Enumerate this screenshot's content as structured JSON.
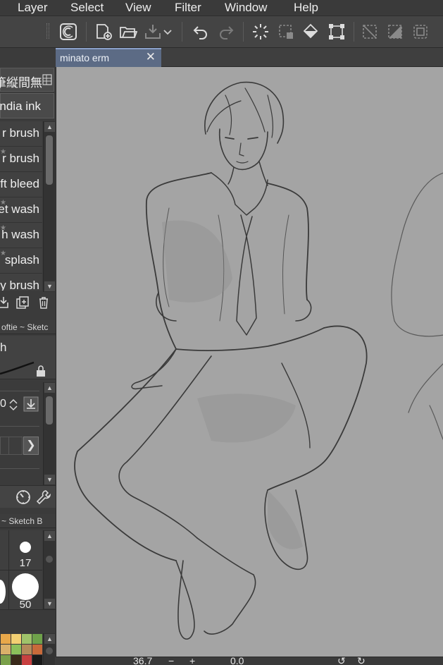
{
  "menu": {
    "items": [
      {
        "label": "Layer",
        "key": "layer"
      },
      {
        "label": "Select",
        "key": "select"
      },
      {
        "label": "View",
        "key": "view"
      },
      {
        "label": "Filter",
        "key": "filter"
      },
      {
        "label": "Window",
        "key": "window"
      },
      {
        "label": "Help",
        "key": "help"
      }
    ]
  },
  "toolbar": {
    "icons": [
      "clip-studio-icon",
      "new-file-icon",
      "open-file-icon",
      "save-icon",
      "undo-icon",
      "redo-icon",
      "clear-icon",
      "fill-icon",
      "transform-icon",
      "deselect-icon",
      "invert-selection-icon",
      "selection-border-icon"
    ]
  },
  "sub_tool": {
    "group_label": "濃い鉛筆縦間無",
    "current_label": "India ink",
    "brushes": [
      {
        "label": "r brush",
        "starred": false
      },
      {
        "label": "r brush",
        "starred": true
      },
      {
        "label": "ft bleed",
        "starred": false
      },
      {
        "label": "et wash",
        "starred": true
      },
      {
        "label": "h wash",
        "starred": true
      },
      {
        "label": "splash",
        "starred": true
      },
      {
        "label": "y brush",
        "starred": false
      }
    ]
  },
  "tool_property": {
    "tab_label": "oftie ~ Sketc",
    "brush_name": "h",
    "size_value": "0"
  },
  "brush_size": {
    "tab_label": "~ Sketch B",
    "sizes": [
      "17",
      "50"
    ]
  },
  "color_set": {
    "colors": [
      "#e8a84a",
      "#f2cf72",
      "#9fc36a",
      "#6fa24a",
      "#d9b06a",
      "#8bbf5a",
      "#b58a5a",
      "#c86a3a",
      "#7aa04a",
      "#3a2a1a",
      "#c84040",
      "#1a1a1a"
    ]
  },
  "document": {
    "tab_title": "minato erm",
    "close_glyph": "✕"
  },
  "status": {
    "zoom": "36.7",
    "angle": "0.0"
  }
}
